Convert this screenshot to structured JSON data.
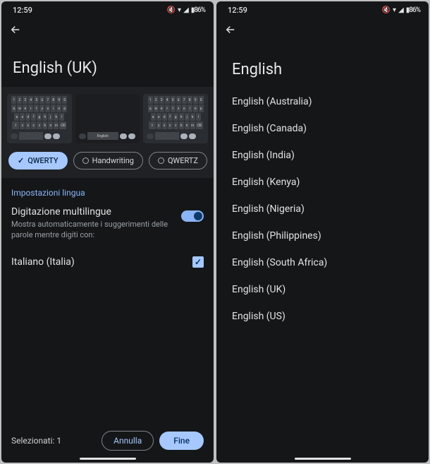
{
  "status": {
    "time": "12:59",
    "icons": "✕ ◢ ◢ ▮ 86%"
  },
  "left": {
    "title": "English (UK)",
    "chips": [
      {
        "label": "QWERTY",
        "selected": true
      },
      {
        "label": "Handwriting",
        "selected": false
      },
      {
        "label": "QWERTZ",
        "selected": false
      }
    ],
    "sectionLabel": "Impostazioni lingua",
    "multilingual": {
      "title": "Digitazione multilingue",
      "subtitle": "Mostra automaticamente i suggerimenti delle parole mentre digiti con:",
      "on": true
    },
    "languageOption": {
      "label": "Italiano (Italia)",
      "checked": true
    },
    "footer": {
      "selected": "Selezionati: 1",
      "cancel": "Annulla",
      "done": "Fine"
    }
  },
  "right": {
    "title": "English",
    "items": [
      "English (Australia)",
      "English (Canada)",
      "English (India)",
      "English (Kenya)",
      "English (Nigeria)",
      "English (Philippines)",
      "English (South Africa)",
      "English (UK)",
      "English (US)"
    ]
  }
}
